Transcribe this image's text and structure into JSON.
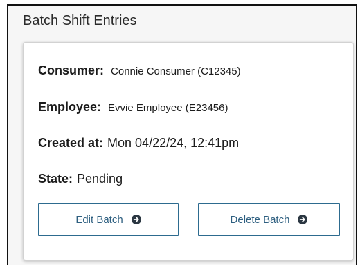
{
  "panel": {
    "title": "Batch Shift Entries"
  },
  "details": {
    "consumer": {
      "label": "Consumer",
      "colon": ":",
      "value": "Connie Consumer (C12345)"
    },
    "employee": {
      "label": "Employee",
      "colon": ":",
      "value": "Evvie Employee (E23456)"
    },
    "created_at": {
      "label": "Created at",
      "colon": ":",
      "value": "Mon 04/22/24, 12:41pm"
    },
    "state": {
      "label": "State",
      "colon": ":",
      "value": "Pending"
    }
  },
  "actions": {
    "edit_label": "Edit Batch",
    "delete_label": "Delete Batch",
    "icon": "circle-arrow-right-icon"
  },
  "colors": {
    "button_border": "#2d6b8f",
    "button_text": "#2e5f80",
    "icon_fill": "#2b3742",
    "panel_background": "#f6f6f6"
  }
}
